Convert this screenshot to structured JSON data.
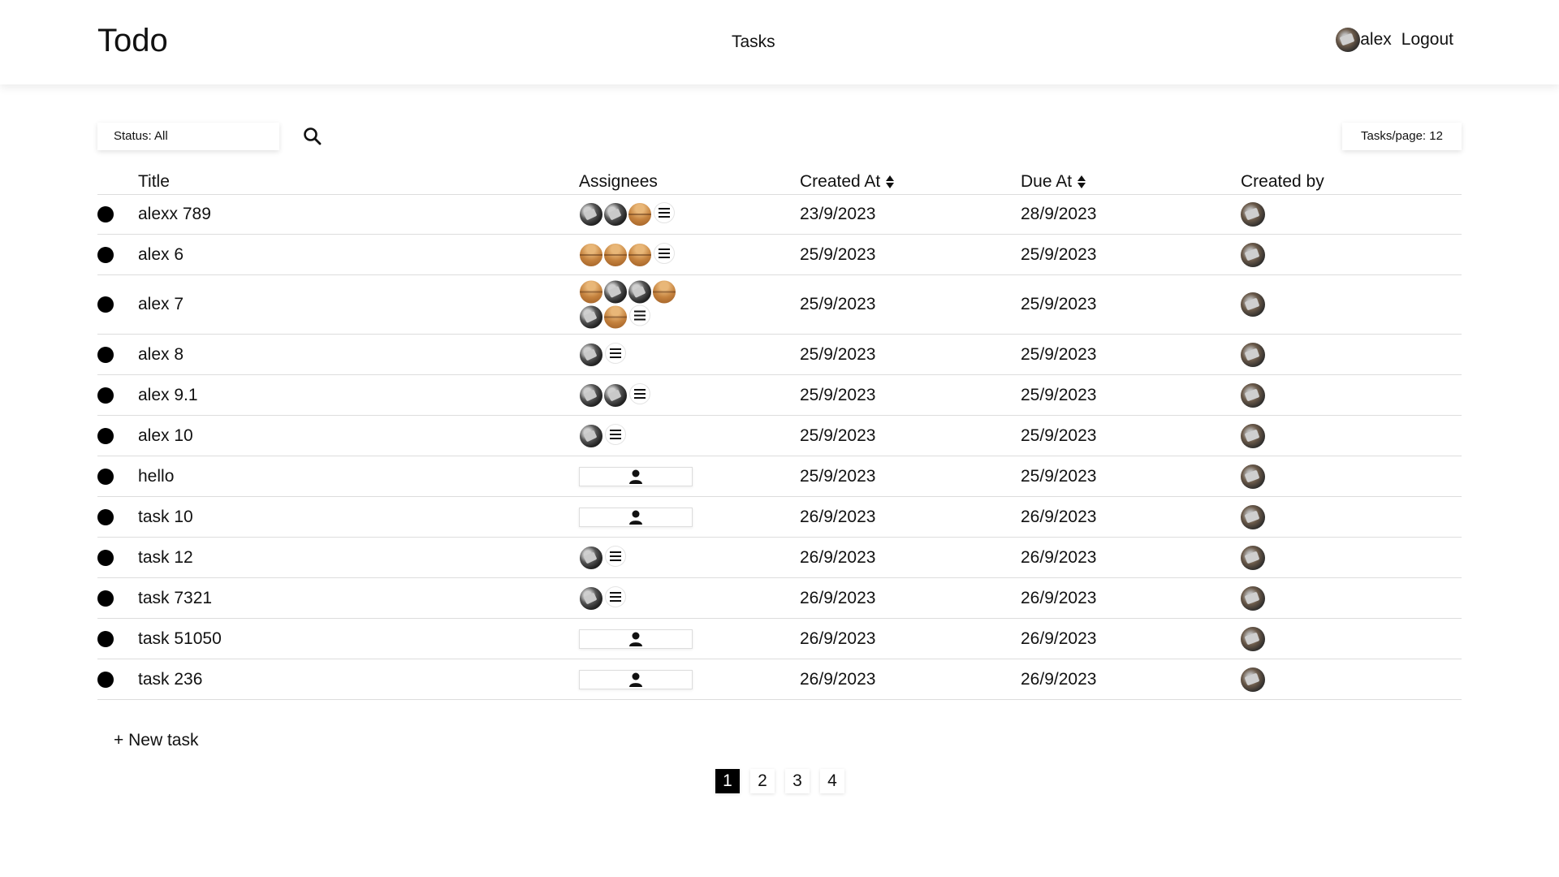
{
  "header": {
    "brand": "Todo",
    "nav_tasks": "Tasks",
    "user_name": "alex",
    "logout": "Logout"
  },
  "toolbar": {
    "status_filter": "Status: All",
    "tasks_per_page": "Tasks/page: 12"
  },
  "table": {
    "columns": [
      "Title",
      "Assignees",
      "Created At",
      "Due At",
      "Created by"
    ],
    "rows": [
      {
        "title": "alexx 789",
        "assignees": [
          "dark",
          "dark",
          "orange"
        ],
        "created_at": "23/9/2023",
        "due_at": "28/9/2023"
      },
      {
        "title": "alex 6",
        "assignees": [
          "orange",
          "orange",
          "orange"
        ],
        "created_at": "25/9/2023",
        "due_at": "25/9/2023"
      },
      {
        "title": "alex 7",
        "assignees": [
          "orange",
          "dark",
          "dark",
          "orange",
          "dark",
          "orange"
        ],
        "created_at": "25/9/2023",
        "due_at": "25/9/2023"
      },
      {
        "title": "alex 8",
        "assignees": [
          "dark"
        ],
        "created_at": "25/9/2023",
        "due_at": "25/9/2023"
      },
      {
        "title": "alex 9.1",
        "assignees": [
          "dark",
          "dark"
        ],
        "created_at": "25/9/2023",
        "due_at": "25/9/2023"
      },
      {
        "title": "alex 10",
        "assignees": [
          "dark"
        ],
        "created_at": "25/9/2023",
        "due_at": "25/9/2023"
      },
      {
        "title": "hello",
        "assignees": [],
        "created_at": "25/9/2023",
        "due_at": "25/9/2023"
      },
      {
        "title": "task 10",
        "assignees": [],
        "created_at": "26/9/2023",
        "due_at": "26/9/2023"
      },
      {
        "title": "task 12",
        "assignees": [
          "dark"
        ],
        "created_at": "26/9/2023",
        "due_at": "26/9/2023"
      },
      {
        "title": "task 7321",
        "assignees": [
          "dark"
        ],
        "created_at": "26/9/2023",
        "due_at": "26/9/2023"
      },
      {
        "title": "task 51050",
        "assignees": [],
        "created_at": "26/9/2023",
        "due_at": "26/9/2023"
      },
      {
        "title": "task 236",
        "assignees": [],
        "created_at": "26/9/2023",
        "due_at": "26/9/2023"
      }
    ]
  },
  "new_task": "+ New task",
  "pagination": {
    "pages": [
      "1",
      "2",
      "3",
      "4"
    ],
    "current": "1"
  },
  "icons": {
    "search": "search-icon",
    "sort": "sort-icon",
    "more": "menu-icon",
    "add_assignee": "person-icon",
    "status_dot": "status-dot"
  }
}
